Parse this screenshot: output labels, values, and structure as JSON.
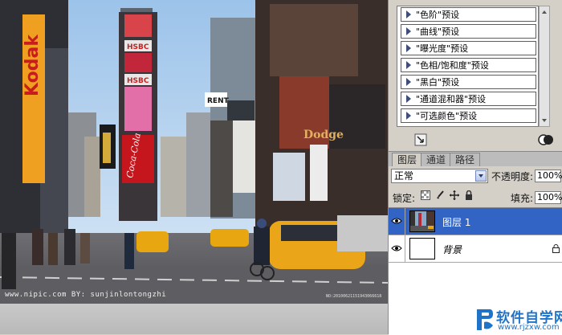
{
  "canvas": {
    "watermark_left": "www.nipic.com    BY: sunjinlontongzhi",
    "watermark_right": "NO:20100621151943066618",
    "signs": {
      "kodak": "Kodak",
      "hsbc1": "HSBC",
      "hsbc2": "HSBC",
      "rent": "RENT",
      "cocacola": "Coca-Cola",
      "dodge": "Dodge"
    }
  },
  "adjustments": {
    "presets": [
      "\"色阶\"预设",
      "\"曲线\"预设",
      "\"曝光度\"预设",
      "\"色相/饱和度\"预设",
      "\"黑白\"预设",
      "\"通道混和器\"预设",
      "\"可选颜色\"预设"
    ]
  },
  "layers_panel": {
    "tabs": [
      "图层",
      "通道",
      "路径"
    ],
    "blend_mode": "正常",
    "opacity_label": "不透明度:",
    "opacity_value": "100%",
    "lock_label": "锁定:",
    "fill_label": "填充:",
    "fill_value": "100%",
    "layers": [
      {
        "name": "图层 1",
        "selected": true
      },
      {
        "name": "背景",
        "selected": false
      }
    ]
  },
  "logo": {
    "main": "软件自学网",
    "sub": "www.rjzxw.com"
  },
  "colors": {
    "selection": "#3164c4",
    "logo_blue": "#1f73c9",
    "panel_bg": "#d4d0c8"
  }
}
